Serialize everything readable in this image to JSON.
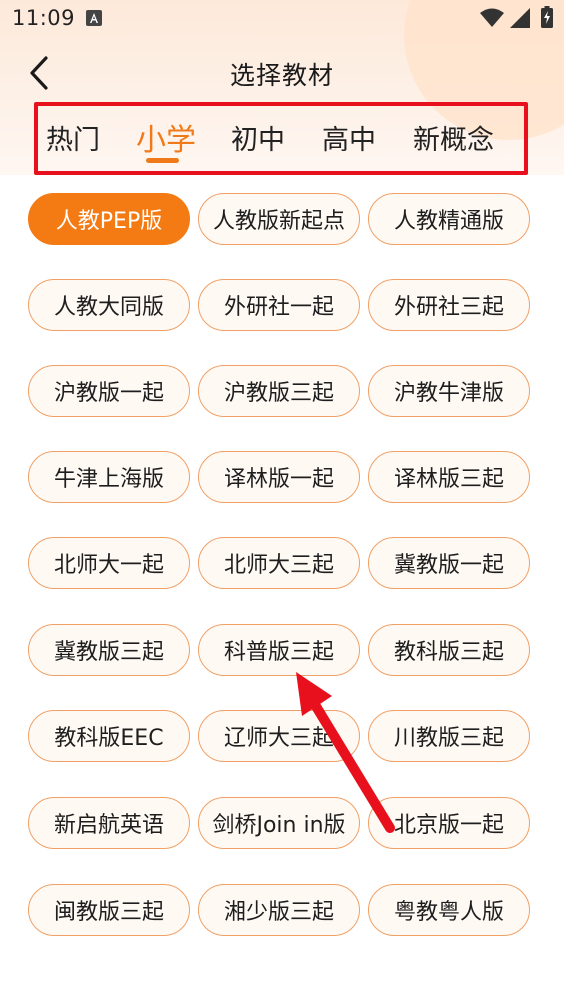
{
  "status_bar": {
    "time": "11:09",
    "notification_icon": "a-badge-icon",
    "wifi_icon": "wifi-icon",
    "signal_icon": "signal-icon",
    "battery_icon": "battery-charging-icon"
  },
  "header": {
    "title": "选择教材",
    "back_icon": "chevron-left-icon"
  },
  "tabs": [
    {
      "label": "热门",
      "active": false
    },
    {
      "label": "小学",
      "active": true
    },
    {
      "label": "初中",
      "active": false
    },
    {
      "label": "高中",
      "active": false
    },
    {
      "label": "新概念",
      "active": false
    }
  ],
  "textbooks": [
    {
      "label": "人教PEP版",
      "selected": true
    },
    {
      "label": "人教版新起点",
      "selected": false
    },
    {
      "label": "人教精通版",
      "selected": false
    },
    {
      "label": "人教大同版",
      "selected": false
    },
    {
      "label": "外研社一起",
      "selected": false
    },
    {
      "label": "外研社三起",
      "selected": false
    },
    {
      "label": "沪教版一起",
      "selected": false
    },
    {
      "label": "沪教版三起",
      "selected": false
    },
    {
      "label": "沪教牛津版",
      "selected": false
    },
    {
      "label": "牛津上海版",
      "selected": false
    },
    {
      "label": "译林版一起",
      "selected": false
    },
    {
      "label": "译林版三起",
      "selected": false
    },
    {
      "label": "北师大一起",
      "selected": false
    },
    {
      "label": "北师大三起",
      "selected": false
    },
    {
      "label": "冀教版一起",
      "selected": false
    },
    {
      "label": "冀教版三起",
      "selected": false
    },
    {
      "label": "科普版三起",
      "selected": false
    },
    {
      "label": "教科版三起",
      "selected": false
    },
    {
      "label": "教科版EEC",
      "selected": false
    },
    {
      "label": "辽师大三起",
      "selected": false
    },
    {
      "label": "川教版三起",
      "selected": false
    },
    {
      "label": "新启航英语",
      "selected": false
    },
    {
      "label": "剑桥Join in版",
      "selected": false
    },
    {
      "label": "北京版一起",
      "selected": false
    },
    {
      "label": "闽教版三起",
      "selected": false
    },
    {
      "label": "湘少版三起",
      "selected": false
    },
    {
      "label": "粤教粤人版",
      "selected": false
    }
  ],
  "colors": {
    "accent": "#f47a14",
    "chip_border": "#f0a066",
    "annotation_red": "#e8101c"
  }
}
